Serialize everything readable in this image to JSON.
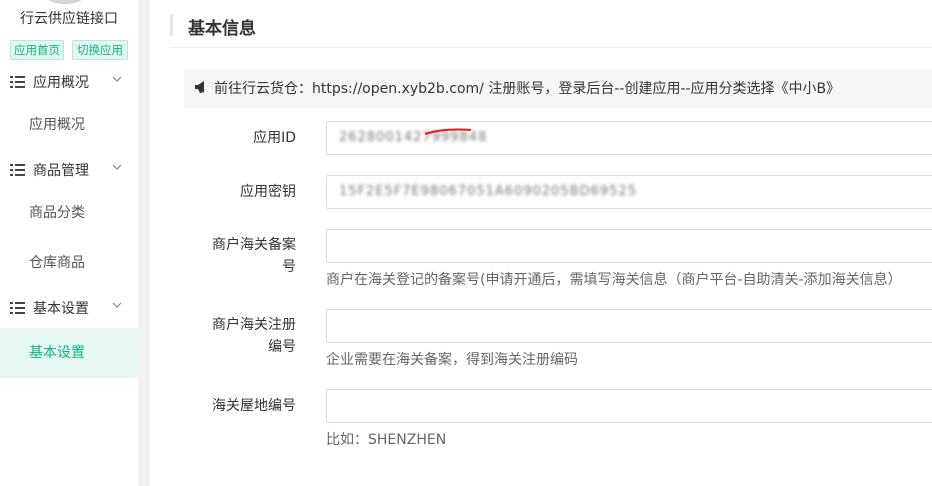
{
  "sidebar": {
    "app_name": "行云供应链接口",
    "tags": {
      "home": "应用首页",
      "switch": "切换应用"
    },
    "groups": [
      {
        "label": "应用概况",
        "items": [
          {
            "label": "应用概况"
          }
        ]
      },
      {
        "label": "商品管理",
        "items": [
          {
            "label": "商品分类"
          },
          {
            "label": "仓库商品"
          }
        ]
      },
      {
        "label": "基本设置",
        "items": [
          {
            "label": "基本设置",
            "active": true
          }
        ]
      }
    ]
  },
  "main": {
    "title": "基本信息",
    "notice": "前往行云货仓：https://open.xyb2b.com/ 注册账号，登录后台--创建应用--应用分类选择《中小B》",
    "fields": [
      {
        "label": "应用ID",
        "value": "2628001427999848",
        "help": ""
      },
      {
        "label": "应用密钥",
        "value": "15F2E5F7E98067051A6090205BD69525",
        "help": ""
      },
      {
        "label": "商户海关备案号",
        "label_line1": "商户海关备案",
        "label_line2": "号",
        "value": "",
        "help": "商户在海关登记的备案号(申请开通后，需填写海关信息（商户平台-自助清关-添加海关信息）"
      },
      {
        "label": "商户海关注册编号",
        "label_line1": "商户海关注册",
        "label_line2": "编号",
        "value": "",
        "help": "企业需要在海关备案，得到海关注册编码"
      },
      {
        "label": "海关屋地编号",
        "value": "",
        "help": "比如：SHENZHEN"
      }
    ]
  },
  "colors": {
    "accent": "#10b38b",
    "accent_bg": "#e6f8f1",
    "scribble": "#e02020"
  },
  "icons": {
    "list": "list-icon",
    "chevron": "chevron-down-icon",
    "speaker": "speaker-icon"
  }
}
